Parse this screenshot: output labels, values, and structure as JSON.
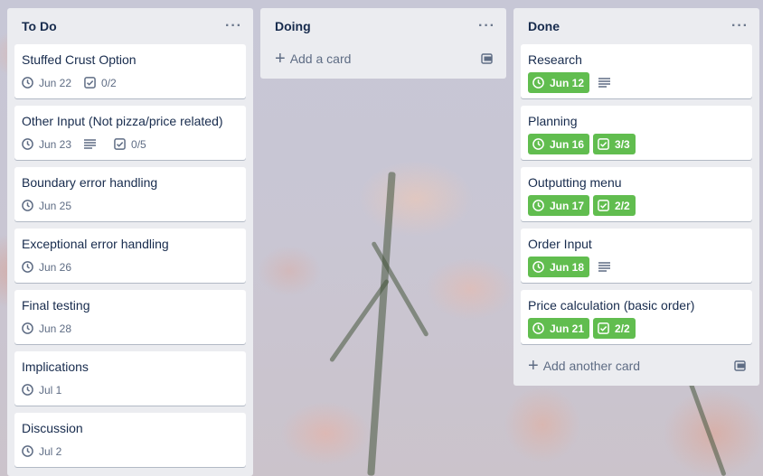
{
  "colors": {
    "label_green": "#61bd4f",
    "list_bg": "#ebecf0"
  },
  "lists": [
    {
      "title": "To Do",
      "cards": [
        {
          "title": "Stuffed Crust Option",
          "due": "Jun 22",
          "checklist": "0/2"
        },
        {
          "title": "Other Input (Not pizza/price related)",
          "due": "Jun 23",
          "has_description": true,
          "checklist": "0/5"
        },
        {
          "title": "Boundary error handling",
          "due": "Jun 25"
        },
        {
          "title": "Exceptional error handling",
          "due": "Jun 26"
        },
        {
          "title": "Final testing",
          "due": "Jun 28"
        },
        {
          "title": "Implications",
          "due": "Jul 1"
        },
        {
          "title": "Discussion",
          "due": "Jul 2"
        }
      ]
    },
    {
      "title": "Doing",
      "add_label": "Add a card"
    },
    {
      "title": "Done",
      "cards": [
        {
          "title": "Research",
          "due": "Jun 12",
          "has_description": true
        },
        {
          "title": "Planning",
          "due": "Jun 16",
          "checklist": "3/3"
        },
        {
          "title": "Outputting menu",
          "due": "Jun 17",
          "checklist": "2/2"
        },
        {
          "title": "Order Input",
          "due": "Jun 18",
          "has_description": true
        },
        {
          "title": "Price calculation (basic order)",
          "due": "Jun 21",
          "checklist": "2/2"
        }
      ],
      "add_label": "Add another card"
    }
  ]
}
